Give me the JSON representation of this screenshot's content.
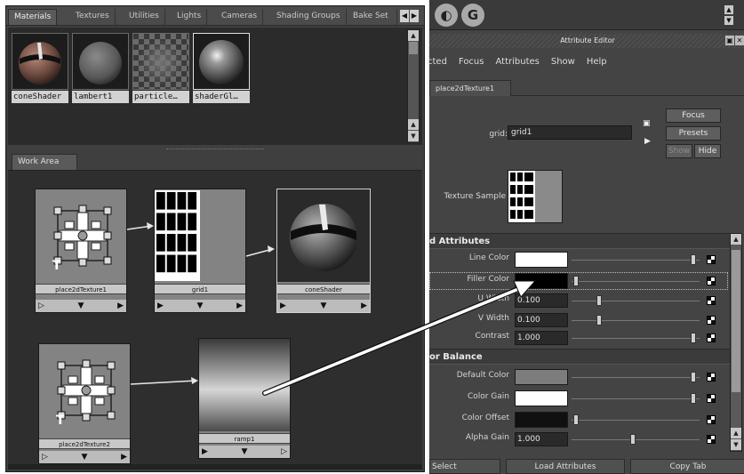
{
  "hypershade": {
    "tabs": [
      {
        "label": "Materials",
        "active": true
      },
      {
        "label": "Textures"
      },
      {
        "label": "Utilities"
      },
      {
        "label": "Lights"
      },
      {
        "label": "Cameras"
      },
      {
        "label": "Shading Groups"
      },
      {
        "label": "Bake Set"
      }
    ],
    "swatches": [
      "coneShader",
      "lambert1",
      "particle…",
      "shaderGl…"
    ],
    "work_area_tab": "Work Area",
    "nodes": {
      "place2d_1": "place2dTexture1",
      "grid": "grid1",
      "cone": "coneShader",
      "place2d_2": "place2dTexture2",
      "ramp": "ramp1"
    }
  },
  "attribute_editor": {
    "title": "Attribute Editor",
    "menu": [
      "cted",
      "Focus",
      "Attributes",
      "Show",
      "Help"
    ],
    "node_tab": "place2dTexture1",
    "node_name_label": "grid:",
    "node_name_value": "grid1",
    "buttons": {
      "focus": "Focus",
      "presets": "Presets",
      "show": "Show",
      "hide": "Hide"
    },
    "texture_sample_label": "Texture Sample",
    "sections": {
      "grid_attributes": "d Attributes",
      "color_balance": "or Balance"
    },
    "attrs": {
      "line_color": "Line Color",
      "filler_color": "Filler Color",
      "u_width": "U Width",
      "u_width_value": "0.100",
      "v_width": "V Width",
      "v_width_value": "0.100",
      "contrast": "Contrast",
      "contrast_value": "1.000",
      "default_color": "Default Color",
      "color_gain": "Color Gain",
      "color_offset": "Color Offset",
      "alpha_gain": "Alpha Gain",
      "alpha_gain_value": "1.000"
    },
    "bottom_buttons": {
      "select": "Select",
      "load": "Load Attributes",
      "copy": "Copy Tab"
    }
  },
  "colors": {
    "line_color": "#ffffff",
    "filler_color": "#000000",
    "default_color": "#7d7d7d",
    "color_gain": "#ffffff",
    "color_offset": "#101010"
  }
}
